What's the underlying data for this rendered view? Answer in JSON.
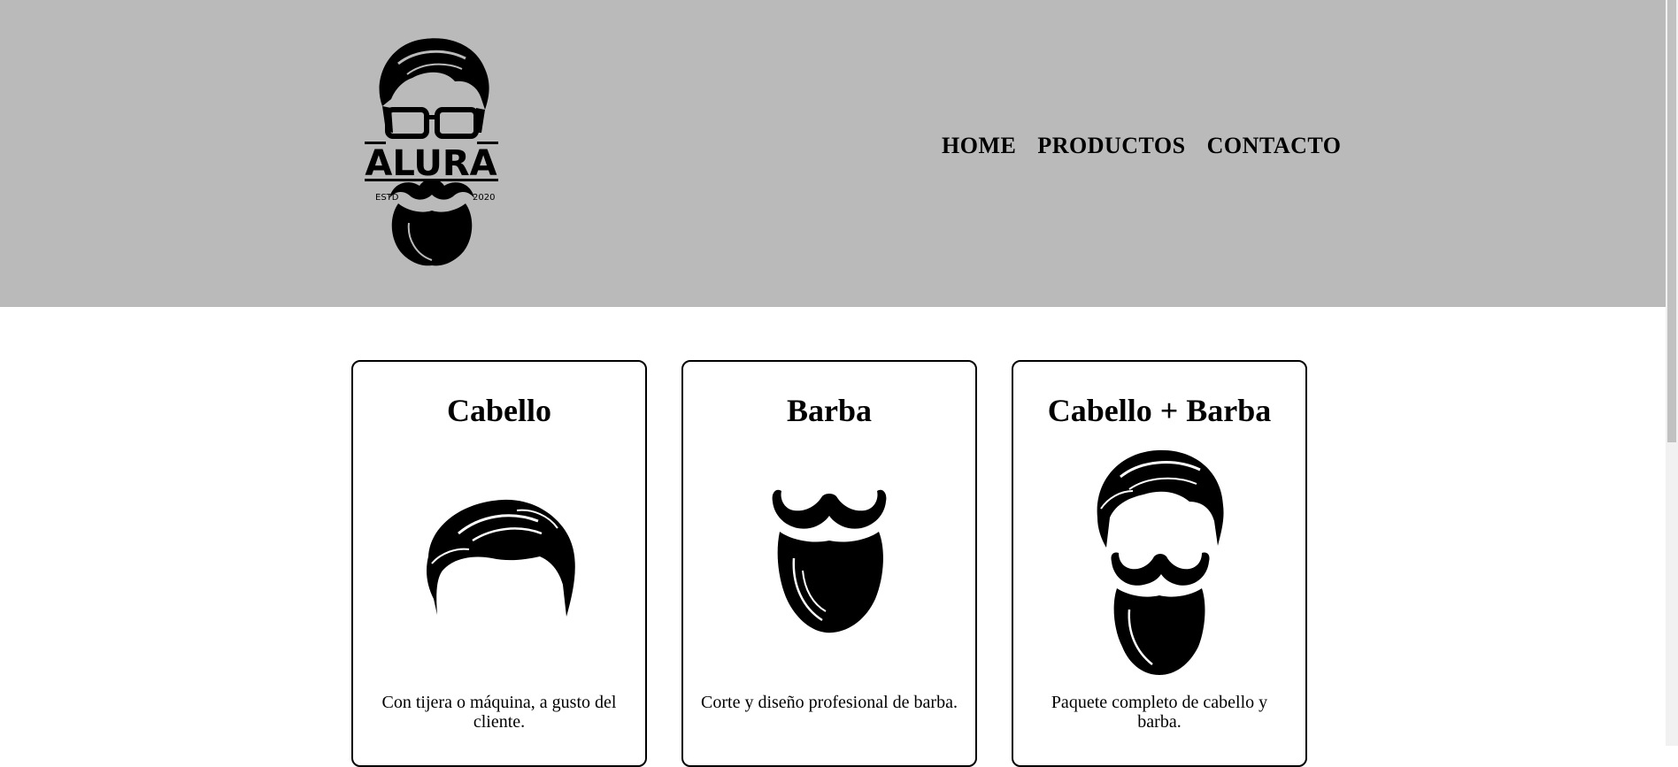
{
  "brand": {
    "name": "ALURA",
    "established_left": "ESTD",
    "established_right": "2020",
    "logo_icon": "bearded-man-glasses-logo"
  },
  "nav": {
    "items": [
      {
        "label": "HOME"
      },
      {
        "label": "PRODUCTOS"
      },
      {
        "label": "CONTACTO"
      }
    ]
  },
  "products": [
    {
      "title": "Cabello",
      "description": "Con tijera o máquina, a gusto del cliente.",
      "icon": "hair-icon"
    },
    {
      "title": "Barba",
      "description": "Corte y diseño profesional de barba.",
      "icon": "beard-icon"
    },
    {
      "title": "Cabello + Barba",
      "description": "Paquete completo de cabello y barba.",
      "icon": "hair-and-beard-icon"
    }
  ],
  "colors": {
    "header_bg": "#bababa",
    "page_bg": "#ffffff",
    "text": "#000000"
  }
}
